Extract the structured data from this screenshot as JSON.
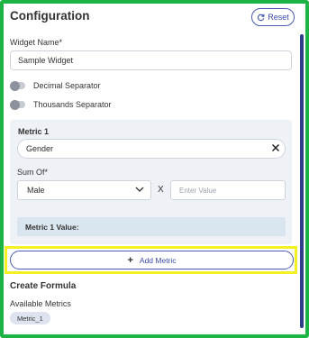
{
  "header": {
    "title": "Configuration",
    "reset_label": "Reset"
  },
  "widget_name": {
    "label": "Widget Name*",
    "value": "Sample Widget"
  },
  "toggles": [
    {
      "label": "Decimal Separator",
      "on": false
    },
    {
      "label": "Thousands Separator",
      "on": false
    }
  ],
  "metric": {
    "title": "Metric 1",
    "field_value": "Gender",
    "sum_of_label": "Sum Of*",
    "sum_of_value": "Male",
    "multiply_symbol": "X",
    "value_placeholder": "Enter Value",
    "value_label": "Metric 1 Value:"
  },
  "add_metric_label": "Add Metric",
  "formula": {
    "title": "Create Formula",
    "available_label": "Available Metrics",
    "chips": [
      "Metric_1"
    ]
  },
  "colors": {
    "frame_border": "#1db345",
    "highlight": "#f4f021",
    "accent": "#3b4aa8"
  }
}
